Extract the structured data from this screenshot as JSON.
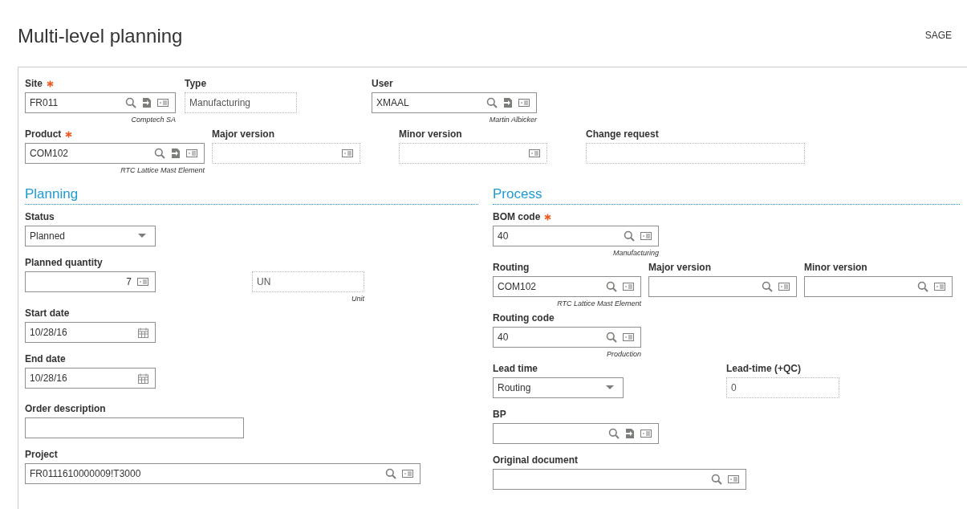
{
  "title": "Multi-level planning",
  "user_badge": "SAGE",
  "header_rows": [
    [
      {
        "label": "Site",
        "required": true,
        "kind": "lookupjump",
        "value": "FR011",
        "note": "Comptech SA",
        "disabled": false
      },
      {
        "label": "Type",
        "required": false,
        "kind": "text",
        "value": "Manufacturing",
        "disabled": true
      },
      {
        "label": "User",
        "required": false,
        "kind": "lookupjump",
        "value": "XMAAL",
        "note": "Martin Albicker",
        "disabled": false
      }
    ],
    [
      {
        "label": "Product",
        "required": true,
        "kind": "lookupjump",
        "value": "COM102",
        "note": "RTC Lattice Mast Element",
        "disabled": false
      },
      {
        "label": "Major version",
        "required": false,
        "kind": "info",
        "disabled": true
      },
      {
        "label": "Minor version",
        "required": false,
        "kind": "info",
        "disabled": true
      },
      {
        "label": "Change request",
        "required": false,
        "kind": "text",
        "disabled": true
      }
    ]
  ],
  "sections": [
    {
      "title": "Planning",
      "rows": [
        [
          {
            "label": "Status",
            "required": false,
            "kind": "select",
            "value": "Planned",
            "disabled": false
          }
        ],
        [
          {
            "label": "Planned quantity",
            "required": false,
            "kind": "number",
            "value": "7",
            "disabled": false
          },
          {
            "kind": "text",
            "value": "UN",
            "note": "Unit",
            "disabled": true,
            "required": false
          }
        ],
        [
          {
            "label": "Start date",
            "required": false,
            "kind": "date",
            "value": "10/28/16",
            "disabled": false
          }
        ],
        [
          {
            "label": "End date",
            "required": false,
            "kind": "date",
            "value": "10/28/16",
            "disabled": false
          }
        ],
        [
          {
            "label": "Order description",
            "required": false,
            "kind": "text",
            "disabled": false
          }
        ],
        [
          {
            "label": "Project",
            "required": false,
            "kind": "lookup",
            "value": "FR0111610000009!T3000",
            "disabled": false
          }
        ]
      ]
    },
    {
      "title": "Process",
      "rows": [
        [
          {
            "label": "BOM code",
            "required": true,
            "kind": "lookup",
            "value": "40",
            "note": "Manufacturing",
            "disabled": false
          }
        ],
        [
          {
            "label": "Routing",
            "required": false,
            "kind": "lookup",
            "value": "COM102",
            "note": "RTC Lattice Mast Element",
            "disabled": false
          },
          {
            "label": "Major version",
            "required": false,
            "kind": "lookup",
            "disabled": false
          },
          {
            "label": "Minor version",
            "required": false,
            "kind": "lookup",
            "disabled": false
          }
        ],
        [
          {
            "label": "Routing code",
            "required": false,
            "kind": "lookup",
            "value": "40",
            "note": "Production",
            "disabled": false
          }
        ],
        [
          {
            "label": "Lead time",
            "required": false,
            "kind": "select",
            "value": "Routing",
            "disabled": false
          },
          {
            "label": "Lead-time (+QC)",
            "required": false,
            "kind": "text",
            "value": "0",
            "disabled": true
          }
        ],
        [
          {
            "label": "BP",
            "required": false,
            "kind": "lookupjump",
            "disabled": false
          }
        ],
        [
          {
            "label": "Original document",
            "required": false,
            "kind": "lookup",
            "disabled": false
          }
        ]
      ]
    }
  ]
}
